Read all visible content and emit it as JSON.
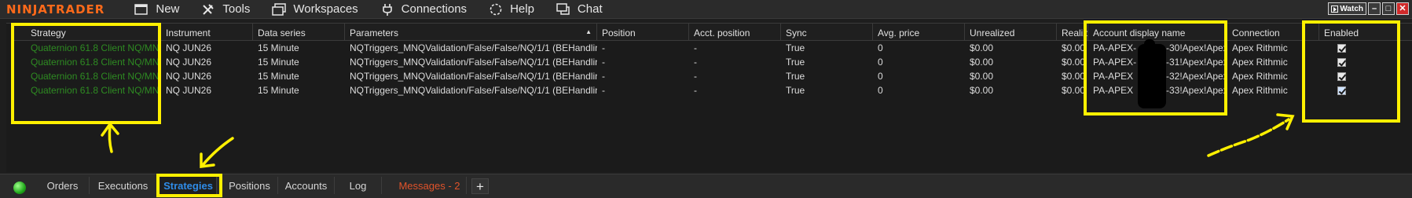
{
  "app": {
    "logo": "NINJATRADER"
  },
  "menu": {
    "items": [
      {
        "label": "New",
        "icon": "new-window-icon"
      },
      {
        "label": "Tools",
        "icon": "tools-icon"
      },
      {
        "label": "Workspaces",
        "icon": "workspaces-icon"
      },
      {
        "label": "Connections",
        "icon": "plug-icon"
      },
      {
        "label": "Help",
        "icon": "help-icon"
      },
      {
        "label": "Chat",
        "icon": "chat-icon"
      }
    ],
    "watch_label": "Watch"
  },
  "grid": {
    "columns": [
      "Strategy",
      "Instrument",
      "Data series",
      "Parameters",
      "Position",
      "Acct. position",
      "Sync",
      "Avg. price",
      "Unrealized",
      "Realiz",
      "Account display name",
      "Connection",
      "Enabled"
    ],
    "sort_indicator": "▲",
    "rows": [
      {
        "strategy": "Quaternion 61.8 Client NQ/MN",
        "instrument": "NQ JUN26",
        "data_series": "15 Minute",
        "parameters": "NQTriggers_MNQValidation/False/False/NQ/1/1 (BEHandlin",
        "position": "-",
        "acct_position": "-",
        "sync": "True",
        "avg_price": "0",
        "unrealized": "$0.00",
        "realized": "$0.00",
        "account": "PA-APEX-",
        "account_tail": "-30!Apex!Apex",
        "connection": "Apex Rithmic",
        "enabled": true
      },
      {
        "strategy": "Quaternion 61.8 Client NQ/MN",
        "instrument": "NQ JUN26",
        "data_series": "15 Minute",
        "parameters": "NQTriggers_MNQValidation/False/False/NQ/1/1 (BEHandlin",
        "position": "-",
        "acct_position": "-",
        "sync": "True",
        "avg_price": "0",
        "unrealized": "$0.00",
        "realized": "$0.00",
        "account": "PA-APEX-",
        "account_tail": "-31!Apex!Apex",
        "connection": "Apex Rithmic",
        "enabled": true
      },
      {
        "strategy": "Quaternion 61.8 Client NQ/MN",
        "instrument": "NQ JUN26",
        "data_series": "15 Minute",
        "parameters": "NQTriggers_MNQValidation/False/False/NQ/1/1 (BEHandlin",
        "position": "-",
        "acct_position": "-",
        "sync": "True",
        "avg_price": "0",
        "unrealized": "$0.00",
        "realized": "$0.00",
        "account": "PA-APEX",
        "account_tail": "-32!Apex!Apex",
        "connection": "Apex Rithmic",
        "enabled": true
      },
      {
        "strategy": "Quaternion 61.8 Client NQ/MN",
        "instrument": "NQ JUN26",
        "data_series": "15 Minute",
        "parameters": "NQTriggers_MNQValidation/False/False/NQ/1/1 (BEHandlin",
        "position": "-",
        "acct_position": "-",
        "sync": "True",
        "avg_price": "0",
        "unrealized": "$0.00",
        "realized": "$0.00",
        "account": "PA-APEX",
        "account_tail": "-33!Apex!Apex",
        "connection": "Apex Rithmic",
        "enabled": true
      }
    ]
  },
  "tabs": {
    "items": [
      "Orders",
      "Executions",
      "Strategies",
      "Positions",
      "Accounts",
      "Log",
      "Messages - 2"
    ],
    "active": "Strategies",
    "add_label": "+"
  },
  "colors": {
    "accent": "#ff6a1a",
    "strategy_text": "#2e8b22",
    "active_tab": "#2f8ce8",
    "messages_tab": "#e0532a",
    "highlight": "#fff000"
  }
}
